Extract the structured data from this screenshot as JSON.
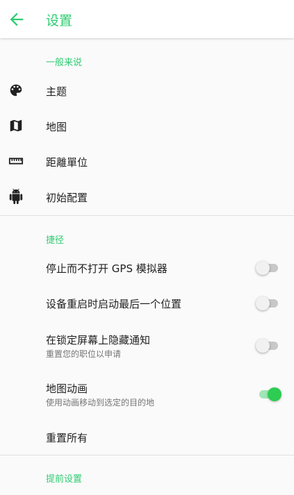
{
  "appbar": {
    "title": "设置",
    "back_icon": "arrow-left-icon"
  },
  "sections": {
    "general": {
      "title": "一般来说",
      "items": [
        {
          "label": "主题",
          "icon": "palette-icon"
        },
        {
          "label": "地图",
          "icon": "map-icon"
        },
        {
          "label": "距離單位",
          "icon": "ruler-icon"
        },
        {
          "label": "初始配置",
          "icon": "android-icon"
        }
      ]
    },
    "shortcuts": {
      "title": "捷径",
      "items": [
        {
          "label": "停止而不打开 GPS 模拟器",
          "subtitle": "",
          "toggle": false
        },
        {
          "label": "设备重启时启动最后一个位置",
          "subtitle": "",
          "toggle": false
        },
        {
          "label": "在锁定屏幕上隐藏通知",
          "subtitle": "重置您的职位以申请",
          "toggle": false
        },
        {
          "label": "地图动画",
          "subtitle": "使用动画移动到选定的目的地",
          "toggle": true
        },
        {
          "label": "重置所有"
        }
      ]
    },
    "advanced": {
      "title": "提前设置"
    }
  },
  "colors": {
    "accent": "#2ecc71",
    "divider": "#e0e0e0",
    "background": "#fafafa"
  }
}
